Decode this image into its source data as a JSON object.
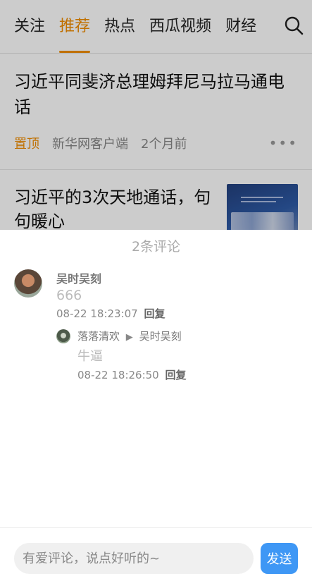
{
  "tabs": [
    {
      "label": "关注"
    },
    {
      "label": "推荐"
    },
    {
      "label": "热点"
    },
    {
      "label": "西瓜视频"
    },
    {
      "label": "财经"
    }
  ],
  "active_tab": "推荐",
  "accent_color": "#f08c00",
  "feed": {
    "items": [
      {
        "title": "习近平同斐济总理姆拜尼马拉马通电话",
        "pin_label": "置顶",
        "source": "新华网客户端",
        "time": "2个月前",
        "more_icon": "more-dots-icon"
      },
      {
        "title": "习近平的3次天地通话，句句暖心",
        "thumb": "news-thumbnail"
      }
    ]
  },
  "comments_panel": {
    "header": "2条评论",
    "comments": [
      {
        "user": "吴时吴刻",
        "text": "666",
        "time": "08-22 18:23:07",
        "reply_label": "回复",
        "replies": [
          {
            "user": "落落清欢",
            "reply_to": "吴时吴刻",
            "arrow": "▶",
            "text": "牛逼",
            "time": "08-22 18:26:50",
            "reply_label": "回复"
          }
        ]
      }
    ]
  },
  "input_bar": {
    "placeholder": "有爱评论，说点好听的~",
    "send_label": "发送",
    "send_color": "#3e97f5"
  }
}
